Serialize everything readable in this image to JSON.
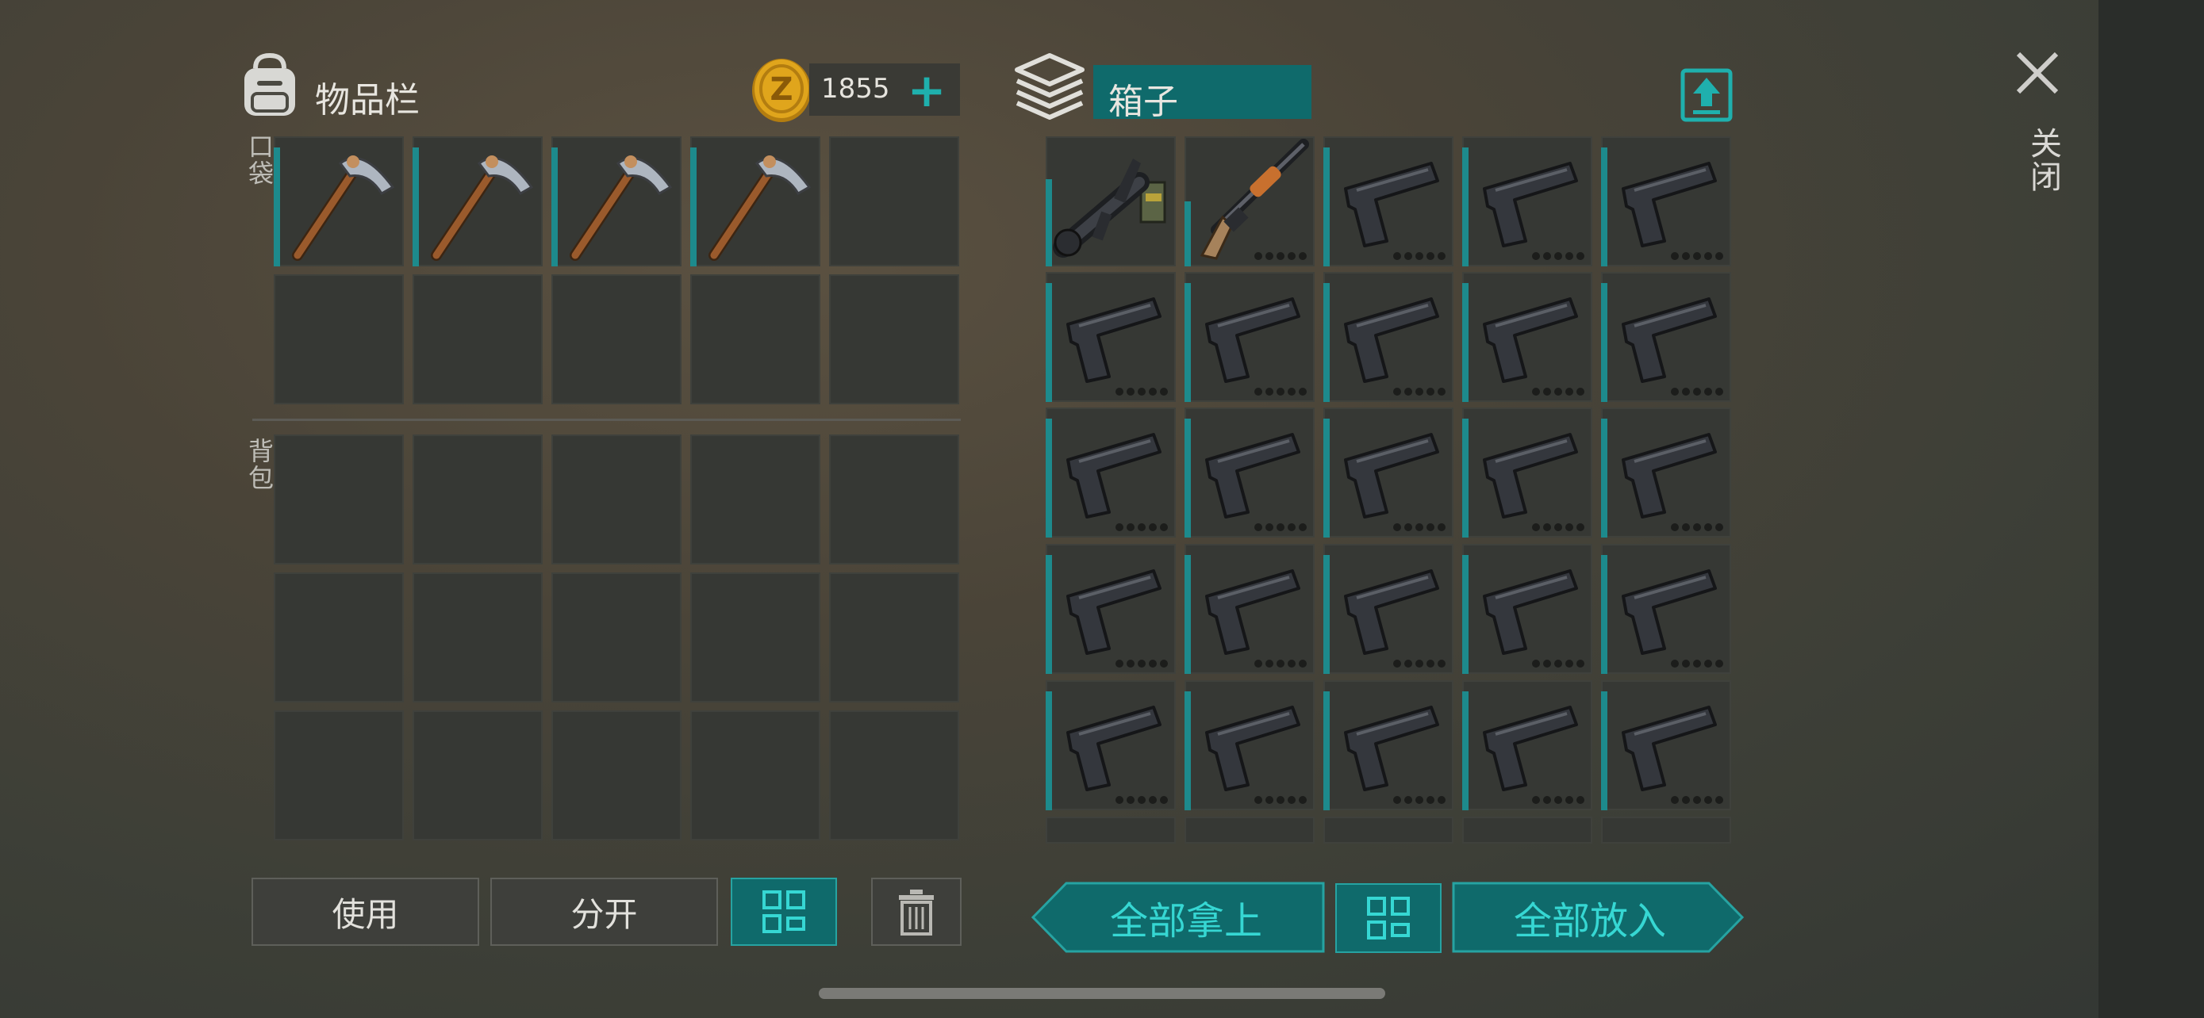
{
  "inventory": {
    "title": "物品栏",
    "pocket_label": "口袋",
    "backpack_label": "背包",
    "coins": "1855",
    "pocket_slots": [
      "pickaxe",
      "pickaxe",
      "pickaxe",
      "pickaxe",
      "",
      "",
      "",
      "",
      "",
      ""
    ],
    "backpack_slots": [
      "",
      "",
      "",
      "",
      "",
      "",
      "",
      "",
      "",
      "",
      "",
      "",
      "",
      "",
      ""
    ]
  },
  "box": {
    "title": "箱子",
    "slots": [
      "grenade-launcher",
      "shotgun",
      "pistol",
      "pistol",
      "pistol",
      "pistol",
      "pistol",
      "pistol",
      "pistol",
      "pistol",
      "pistol",
      "pistol",
      "pistol",
      "pistol",
      "pistol",
      "pistol",
      "pistol",
      "pistol",
      "pistol",
      "pistol",
      "pistol",
      "pistol",
      "pistol",
      "pistol",
      "pistol"
    ]
  },
  "buttons": {
    "use": "使用",
    "split": "分开",
    "take_all": "全部拿上",
    "put_all": "全部放入",
    "close": "关闭"
  },
  "icons": {
    "backpack": "backpack-icon",
    "coin": "coin-icon",
    "box": "box-icon",
    "upload": "upload-icon",
    "sort": "sort-grid-icon",
    "trash": "trash-icon",
    "close": "close-icon"
  },
  "colors": {
    "accent": "#1d8a8c",
    "accent_text": "#36d7d3",
    "coin": "#e0a51c"
  }
}
